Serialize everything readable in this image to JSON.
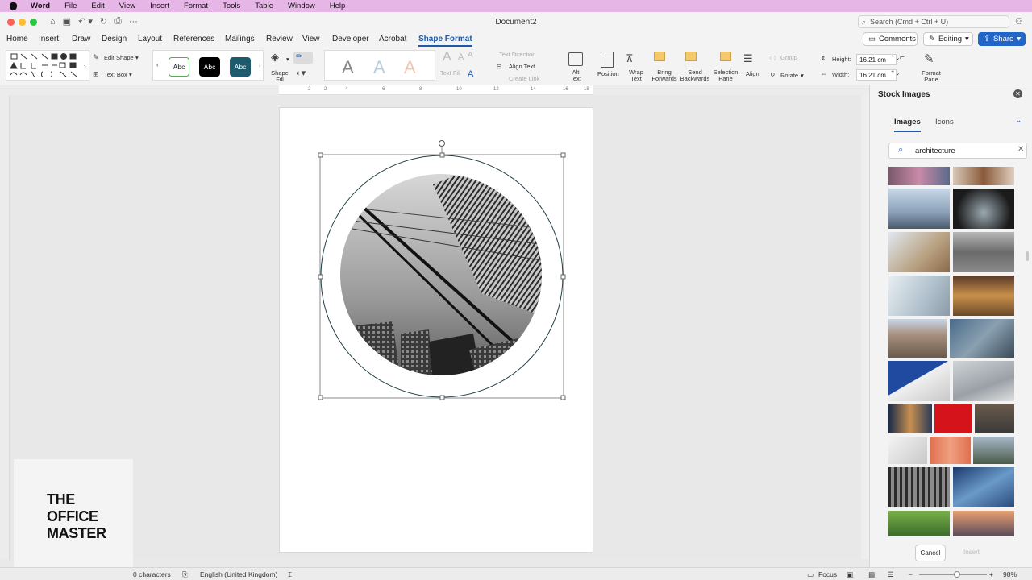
{
  "menubar": {
    "app": "Word",
    "items": [
      "File",
      "Edit",
      "View",
      "Insert",
      "Format",
      "Tools",
      "Table",
      "Window",
      "Help"
    ]
  },
  "window": {
    "title": "Document2",
    "search_placeholder": "Search (Cmd + Ctrl + U)"
  },
  "tabs": [
    "Home",
    "Insert",
    "Draw",
    "Design",
    "Layout",
    "References",
    "Mailings",
    "Review",
    "View",
    "Developer",
    "Acrobat",
    "Shape Format"
  ],
  "active_tab": "Shape Format",
  "top_buttons": {
    "comments": "Comments",
    "editing": "Editing",
    "share": "Share"
  },
  "ribbon": {
    "edit_shape": "Edit Shape",
    "text_box": "Text Box",
    "style_samples": [
      "Abc",
      "Abc",
      "Abc"
    ],
    "shape_fill": [
      "Shape",
      "Fill"
    ],
    "text_fill": "Text Fill",
    "text_direction": "Text Direction",
    "align_text": "Align Text",
    "create_link": "Create Link",
    "alt_text": [
      "Alt",
      "Text"
    ],
    "position": "Position",
    "wrap_text": [
      "Wrap",
      "Text"
    ],
    "bring_forwards": [
      "Bring",
      "Forwards"
    ],
    "send_backwards": [
      "Send",
      "Backwards"
    ],
    "selection_pane": [
      "Selection",
      "Pane"
    ],
    "align": "Align",
    "group": "Group",
    "rotate": "Rotate",
    "height_label": "Height:",
    "height_value": "16.21 cm",
    "width_label": "Width:",
    "width_value": "16.21 cm",
    "format_pane": [
      "Format",
      "Pane"
    ]
  },
  "ruler_marks": [
    "2",
    "2",
    "4",
    "6",
    "8",
    "10",
    "12",
    "14",
    "16",
    "18"
  ],
  "logo": {
    "lines": [
      "THE",
      "OFFICE",
      "MASTER"
    ]
  },
  "pane": {
    "title": "Stock Images",
    "tabs": [
      "Images",
      "Icons"
    ],
    "active_tab": "Images",
    "search_value": "architecture",
    "cancel": "Cancel",
    "insert": "Insert"
  },
  "status": {
    "characters": "0 characters",
    "language": "English (United Kingdom)",
    "focus": "Focus",
    "zoom": "98%"
  },
  "colors": {
    "accent": "#1f5aa6",
    "share": "#2165c9",
    "menubar": "#e6b7e6"
  }
}
